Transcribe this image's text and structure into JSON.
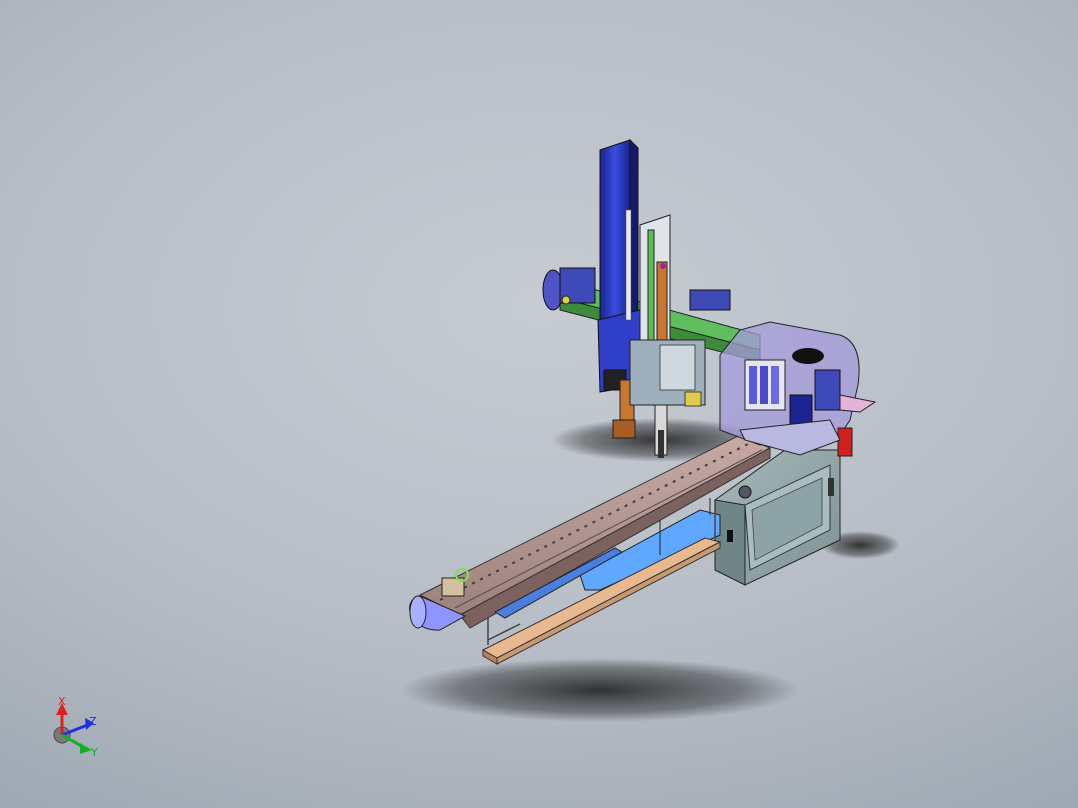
{
  "viewport": {
    "background_top_color": "#b5bcc5",
    "background_bottom_color": "#8c96a3"
  },
  "model": {
    "colors": {
      "column_blue": "#2f3fc8",
      "column_dark_blue": "#1b2490",
      "rail_brown": "#b89a96",
      "belt_pink": "#d6b2a6",
      "beam_green": "#5fbf5f",
      "cabinet_gray": "#8fa3a5",
      "enclosure_purple": "#a49adb",
      "light_blue_panel": "#5fa7ff",
      "wood_plank": "#e8b98f",
      "copper_rod": "#c9762e",
      "red_valve": "#d02020"
    }
  },
  "triad": {
    "x_label": "X",
    "y_label": "Y",
    "z_label": "Z",
    "x_color": "#e02020",
    "y_color": "#10b020",
    "z_color": "#2030e0"
  }
}
